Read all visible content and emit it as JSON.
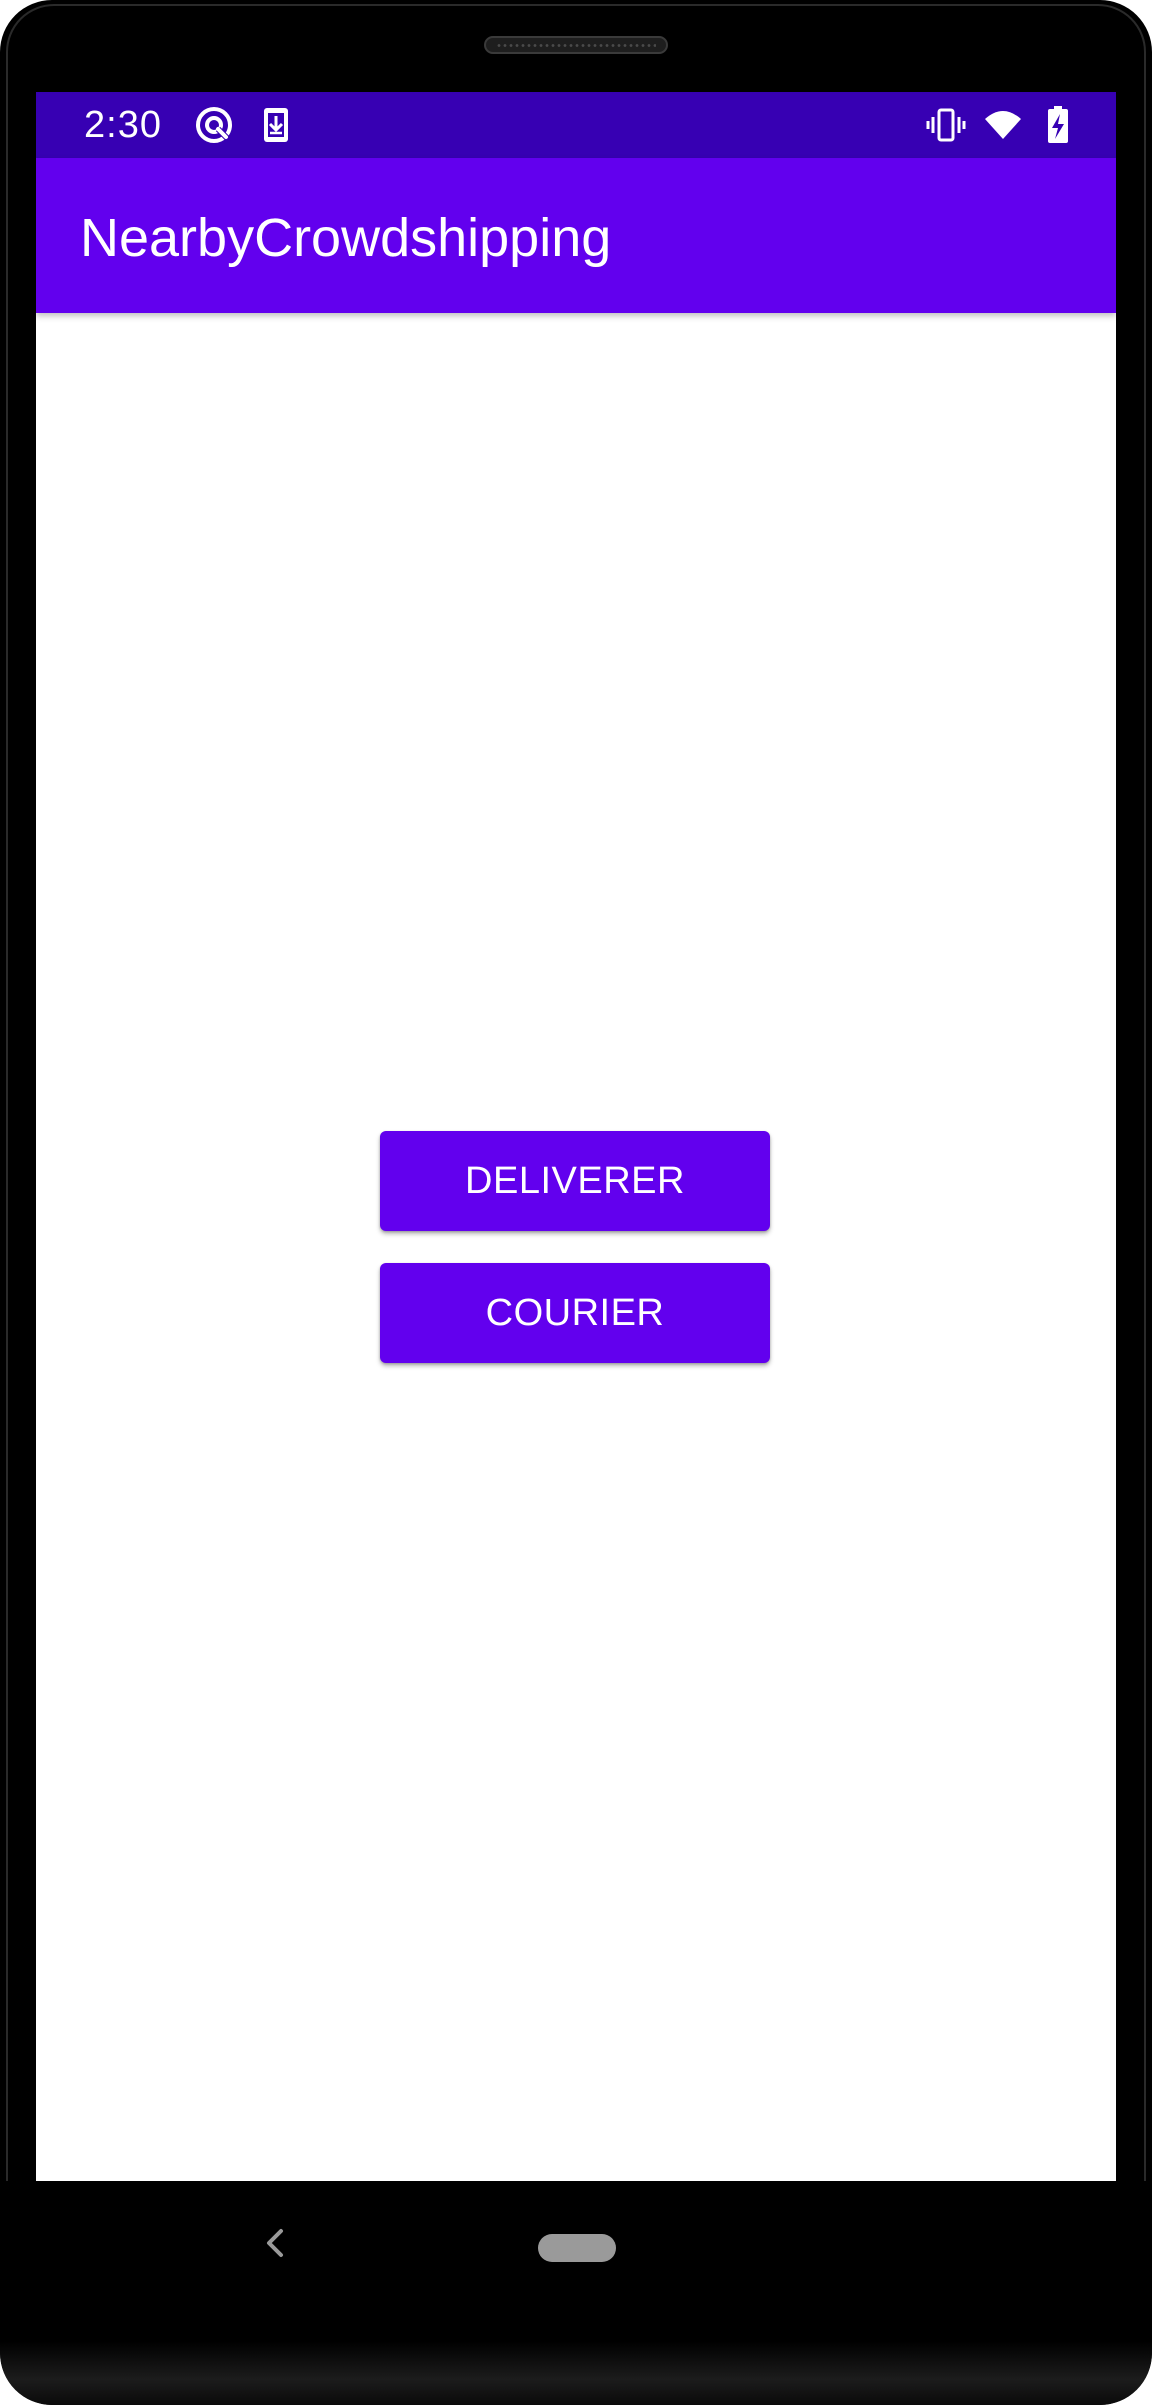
{
  "status_bar": {
    "time": "2:30",
    "left_icons": [
      "sync-icon",
      "download-icon"
    ],
    "right_icons": [
      "vibrate-icon",
      "wifi-icon",
      "battery-charging-icon"
    ],
    "background_color": "#3700b3"
  },
  "app_bar": {
    "title": "NearbyCrowdshipping",
    "background_color": "#6200ee"
  },
  "main": {
    "buttons": [
      {
        "label": "DELIVERER"
      },
      {
        "label": "COURIER"
      }
    ],
    "button_color": "#6200ee"
  },
  "nav_bar": {
    "icons": [
      "back-icon",
      "home-pill-icon"
    ]
  }
}
